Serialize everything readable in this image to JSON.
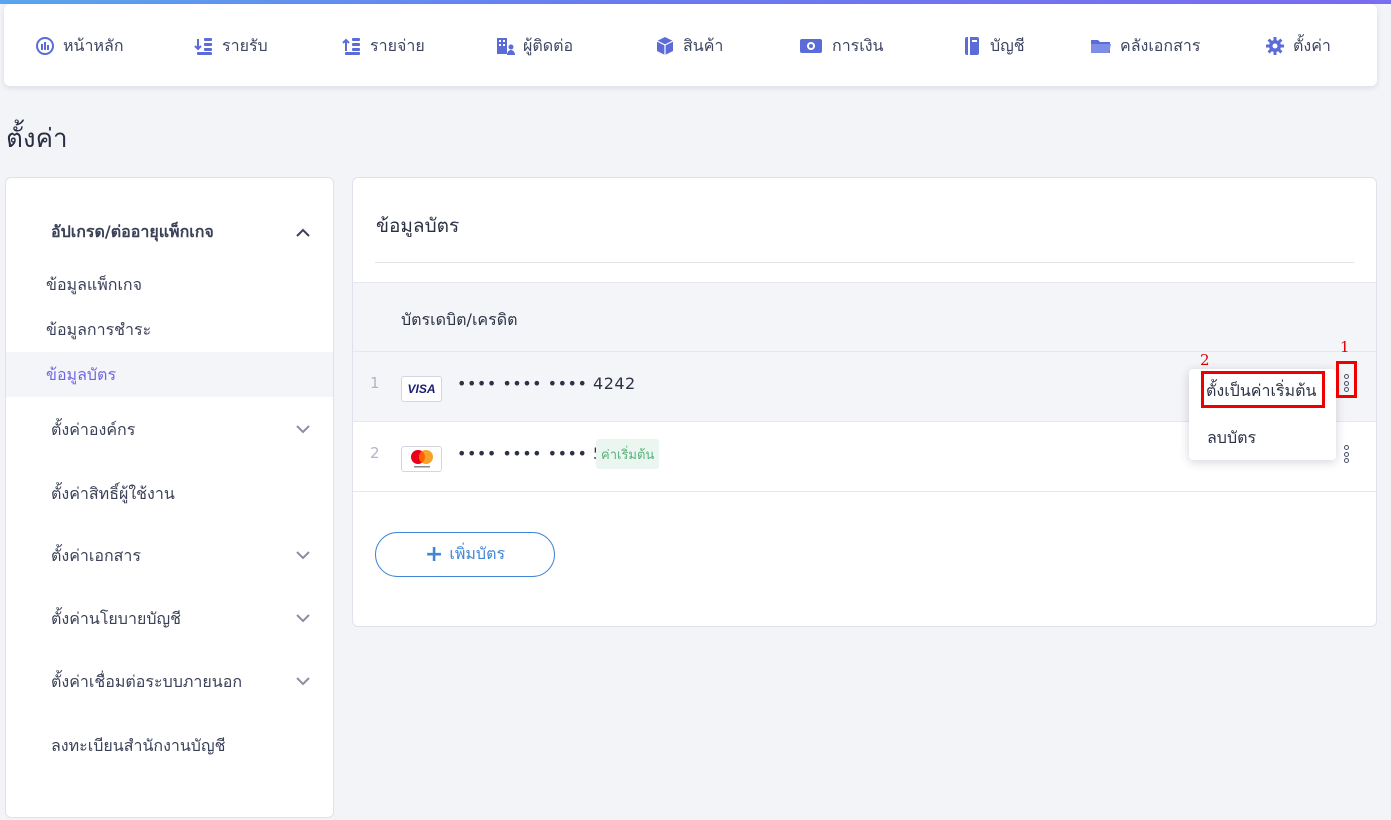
{
  "topnav": {
    "items": [
      {
        "label": "หน้าหลัก",
        "icon": "dashboard-icon"
      },
      {
        "label": "รายรับ",
        "icon": "income-icon"
      },
      {
        "label": "รายจ่าย",
        "icon": "expense-icon"
      },
      {
        "label": "ผู้ติดต่อ",
        "icon": "contacts-icon"
      },
      {
        "label": "สินค้า",
        "icon": "product-box-icon"
      },
      {
        "label": "การเงิน",
        "icon": "money-icon"
      },
      {
        "label": "บัญชี",
        "icon": "ledger-icon"
      },
      {
        "label": "คลังเอกสาร",
        "icon": "folder-icon"
      },
      {
        "label": "ตั้งค่า",
        "icon": "gear-icon"
      }
    ]
  },
  "page": {
    "title": "ตั้งค่า"
  },
  "sidebar": {
    "groups": [
      {
        "label": "อัปเกรด/ต่ออายุแพ็กเกจ",
        "expanded": true
      },
      {
        "label": "ตั้งค่าองค์กร",
        "expanded": false
      },
      {
        "label": "ตั้งค่าสิทธิ์ผู้ใช้งาน"
      },
      {
        "label": "ตั้งค่าเอกสาร",
        "expanded": false
      },
      {
        "label": "ตั้งค่านโยบายบัญชี",
        "expanded": false
      },
      {
        "label": "ตั้งค่าเชื่อมต่อระบบภายนอก",
        "expanded": false
      },
      {
        "label": "ลงทะเบียนสำนักงานบัญชี"
      }
    ],
    "sub_items": [
      {
        "label": "ข้อมูลแพ็กเกจ"
      },
      {
        "label": "ข้อมูลการชำระ"
      },
      {
        "label": "ข้อมูลบัตร",
        "active": true
      }
    ]
  },
  "main": {
    "title": "ข้อมูลบัตร",
    "table_header": "บัตรเดบิต/เครดิต",
    "cards": [
      {
        "index": "1",
        "brand": "VISA",
        "number": "•••• •••• •••• 4242",
        "badge": ""
      },
      {
        "index": "2",
        "brand": "mastercard",
        "number": "•••• •••• •••• 5454",
        "badge": "ค่าเริ่มต้น"
      }
    ],
    "add_button": "เพิ่มบัตร"
  },
  "dropdown": {
    "options": [
      "ตั้งเป็นค่าเริ่มต้น",
      "ลบบัตร"
    ]
  },
  "annotations": {
    "label_1": "1",
    "label_2": "2",
    "color": "#ee0000"
  },
  "colors": {
    "accent": "#6f66e8",
    "link_blue": "#3f86d8",
    "badge_green": "#58b17c"
  }
}
